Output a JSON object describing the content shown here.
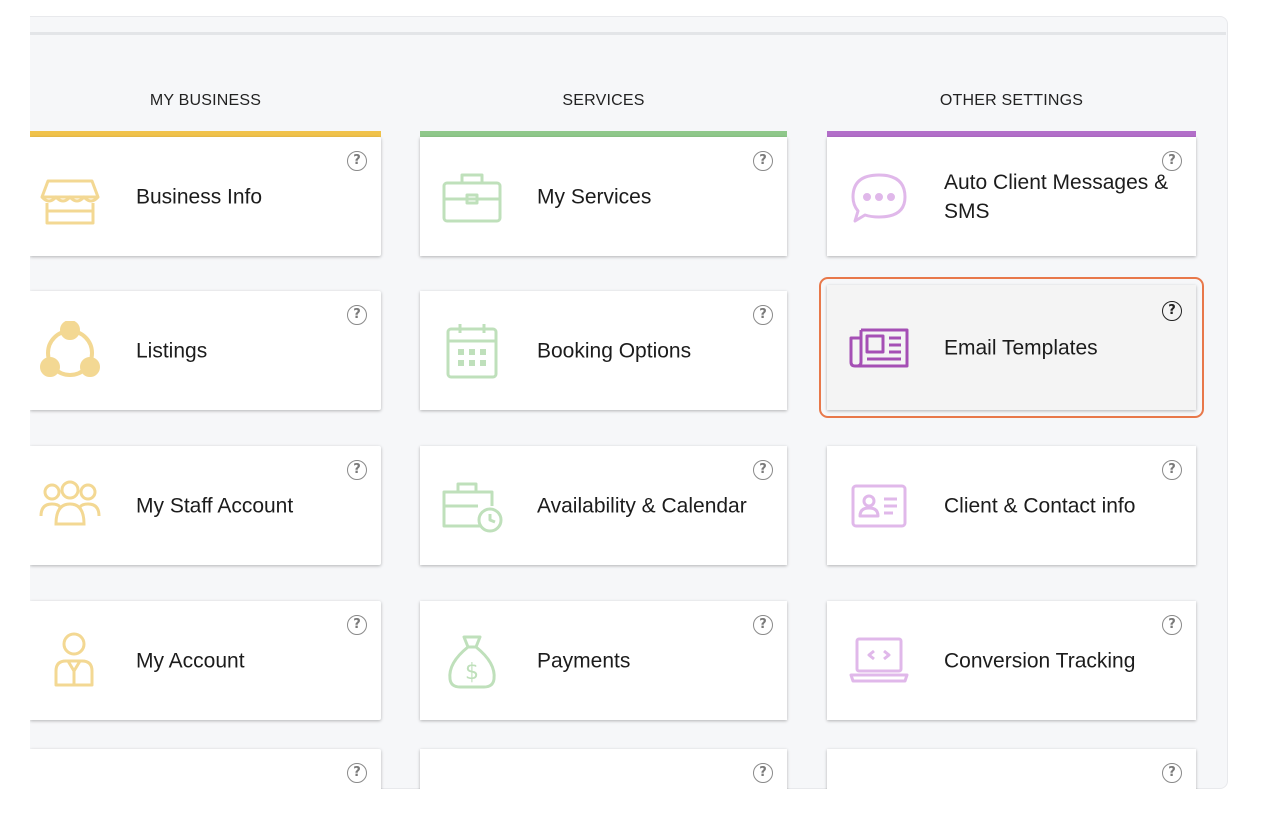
{
  "columns": [
    {
      "title": "MY BUSINESS",
      "accent": "#f0c24b"
    },
    {
      "title": "SERVICES",
      "accent": "#8fc88a"
    },
    {
      "title": "OTHER SETTINGS",
      "accent": "#b26ec9"
    }
  ],
  "help_glyph": "?",
  "business": {
    "business_info": "Business Info",
    "listings": "Listings",
    "staff_account": "My Staff Account",
    "my_account": "My Account"
  },
  "services": {
    "my_services": "My Services",
    "booking_options": "Booking Options",
    "availability": "Availability & Calendar",
    "payments": "Payments"
  },
  "other": {
    "auto_messages": "Auto Client Messages & SMS",
    "email_templates": "Email Templates",
    "client_contact": "Client & Contact info",
    "conversion": "Conversion Tracking"
  },
  "icons": {
    "business_info": "storefront-icon",
    "listings": "network-icon",
    "staff_account": "team-icon",
    "my_account": "person-icon",
    "my_services": "briefcase-icon",
    "booking_options": "calendar-icon",
    "availability": "briefcase-clock-icon",
    "payments": "money-bag-icon",
    "auto_messages": "chat-bubble-icon",
    "email_templates": "newspaper-icon",
    "client_contact": "id-card-icon",
    "conversion": "laptop-code-icon"
  }
}
